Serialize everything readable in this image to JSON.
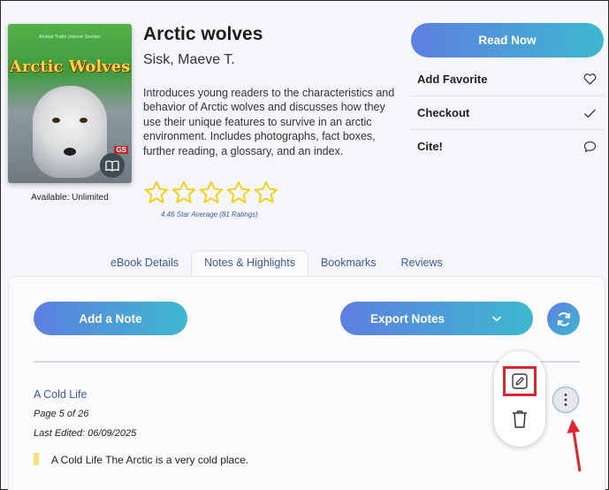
{
  "book": {
    "cover_series": "Animal Traits Interior Section",
    "cover_title": "Arctic Wolves",
    "cover_publisher": "GS",
    "read_icon": "book-open-icon",
    "availability": "Available: Unlimited",
    "title": "Arctic wolves",
    "author": "Sisk, Maeve T.",
    "description": "Introduces young readers to the characteristics and behavior of Arctic wolves and discusses how they use their unique features to survive in an arctic environment. Includes photographs, fact boxes, further reading, a glossary, and an index.",
    "rating_stars_filled": 0,
    "rating_stars_total": 5,
    "rating_text": "4.46 Star Average (81 Ratings)"
  },
  "actions": {
    "read_now": "Read Now",
    "items": [
      {
        "label": "Add Favorite",
        "icon": "heart-icon"
      },
      {
        "label": "Checkout",
        "icon": "check-icon"
      },
      {
        "label": "Cite!",
        "icon": "speech-bubble-icon"
      }
    ]
  },
  "tabs": [
    {
      "label": "eBook Details",
      "active": false
    },
    {
      "label": "Notes & Highlights",
      "active": true
    },
    {
      "label": "Bookmarks",
      "active": false
    },
    {
      "label": "Reviews",
      "active": false
    }
  ],
  "notes_panel": {
    "add_note": "Add a Note",
    "export_notes": "Export Notes",
    "export_icon": "chevron-down-icon",
    "refresh_icon": "refresh-icon"
  },
  "note": {
    "title": "A Cold Life",
    "page": "Page 5 of 26",
    "last_edited": "Last Edited: 06/09/2025",
    "highlight_color": "#f6e27a",
    "text": "A Cold Life The Arctic is a very cold place."
  },
  "menu": {
    "edit_icon": "pencil-icon",
    "delete_icon": "trash-icon",
    "more_icon": "vertical-ellipsis-icon",
    "annotation_highlight_color": "#e0242d",
    "pointer_icon": "red-arrow-icon"
  },
  "colors": {
    "accent_start": "#5d7fe0",
    "accent_end": "#3db8cf",
    "link": "#3a59a6",
    "star": "#f2d21d"
  }
}
